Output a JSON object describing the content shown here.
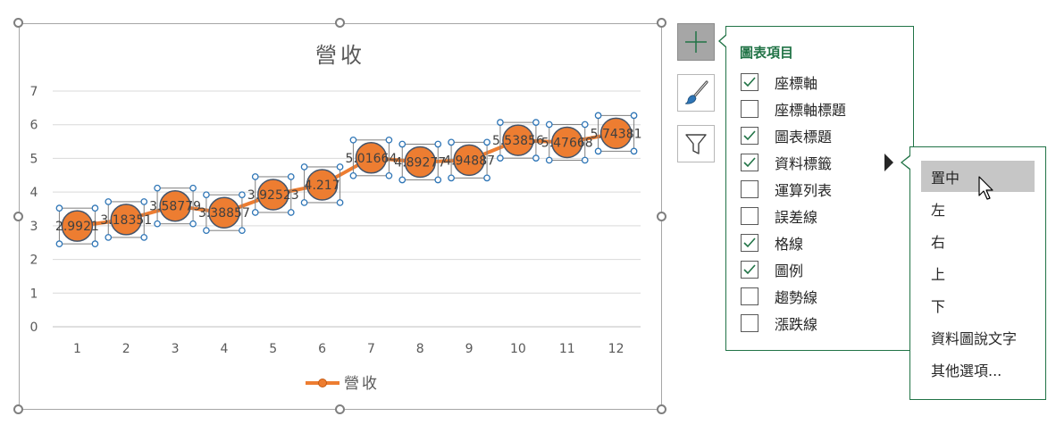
{
  "chart_data": {
    "type": "line",
    "title": "營收",
    "categories": [
      "1",
      "2",
      "3",
      "4",
      "5",
      "6",
      "7",
      "8",
      "9",
      "10",
      "11",
      "12"
    ],
    "series": [
      {
        "name": "營收",
        "values": [
          2.9921,
          3.18351,
          3.58779,
          3.38857,
          3.92523,
          4.217,
          5.01664,
          4.89277,
          4.94887,
          5.53856,
          5.47668,
          5.74381
        ],
        "labels": [
          "2.9921",
          "3.18351",
          "3.58779",
          "3.38857",
          "3.92523",
          "4.217",
          "5.01664",
          "4.89277",
          "4.94887",
          "5.53856",
          "5.47668",
          "5.74381"
        ]
      }
    ],
    "y_ticks": [
      "0",
      "1",
      "2",
      "3",
      "4",
      "5",
      "6",
      "7"
    ],
    "ylim": [
      0,
      7
    ],
    "grid": true,
    "legend_position": "bottom",
    "data_label_position": "center",
    "series_color": "#ED7D31"
  },
  "side_buttons": {
    "elements": "plus-icon",
    "styles": "brush-icon",
    "filters": "filter-icon"
  },
  "elements_panel": {
    "title": "圖表項目",
    "accent_color": "#217346",
    "items": [
      {
        "label": "座標軸",
        "checked": true
      },
      {
        "label": "座標軸標題",
        "checked": false
      },
      {
        "label": "圖表標題",
        "checked": true
      },
      {
        "label": "資料標籤",
        "checked": true
      },
      {
        "label": "運算列表",
        "checked": false
      },
      {
        "label": "誤差線",
        "checked": false
      },
      {
        "label": "格線",
        "checked": true
      },
      {
        "label": "圖例",
        "checked": true
      },
      {
        "label": "趨勢線",
        "checked": false
      },
      {
        "label": "漲跌線",
        "checked": false
      }
    ]
  },
  "label_submenu": {
    "items": [
      "置中",
      "左",
      "右",
      "上",
      "下",
      "資料圖說文字",
      "其他選項..."
    ],
    "hovered": "置中"
  }
}
